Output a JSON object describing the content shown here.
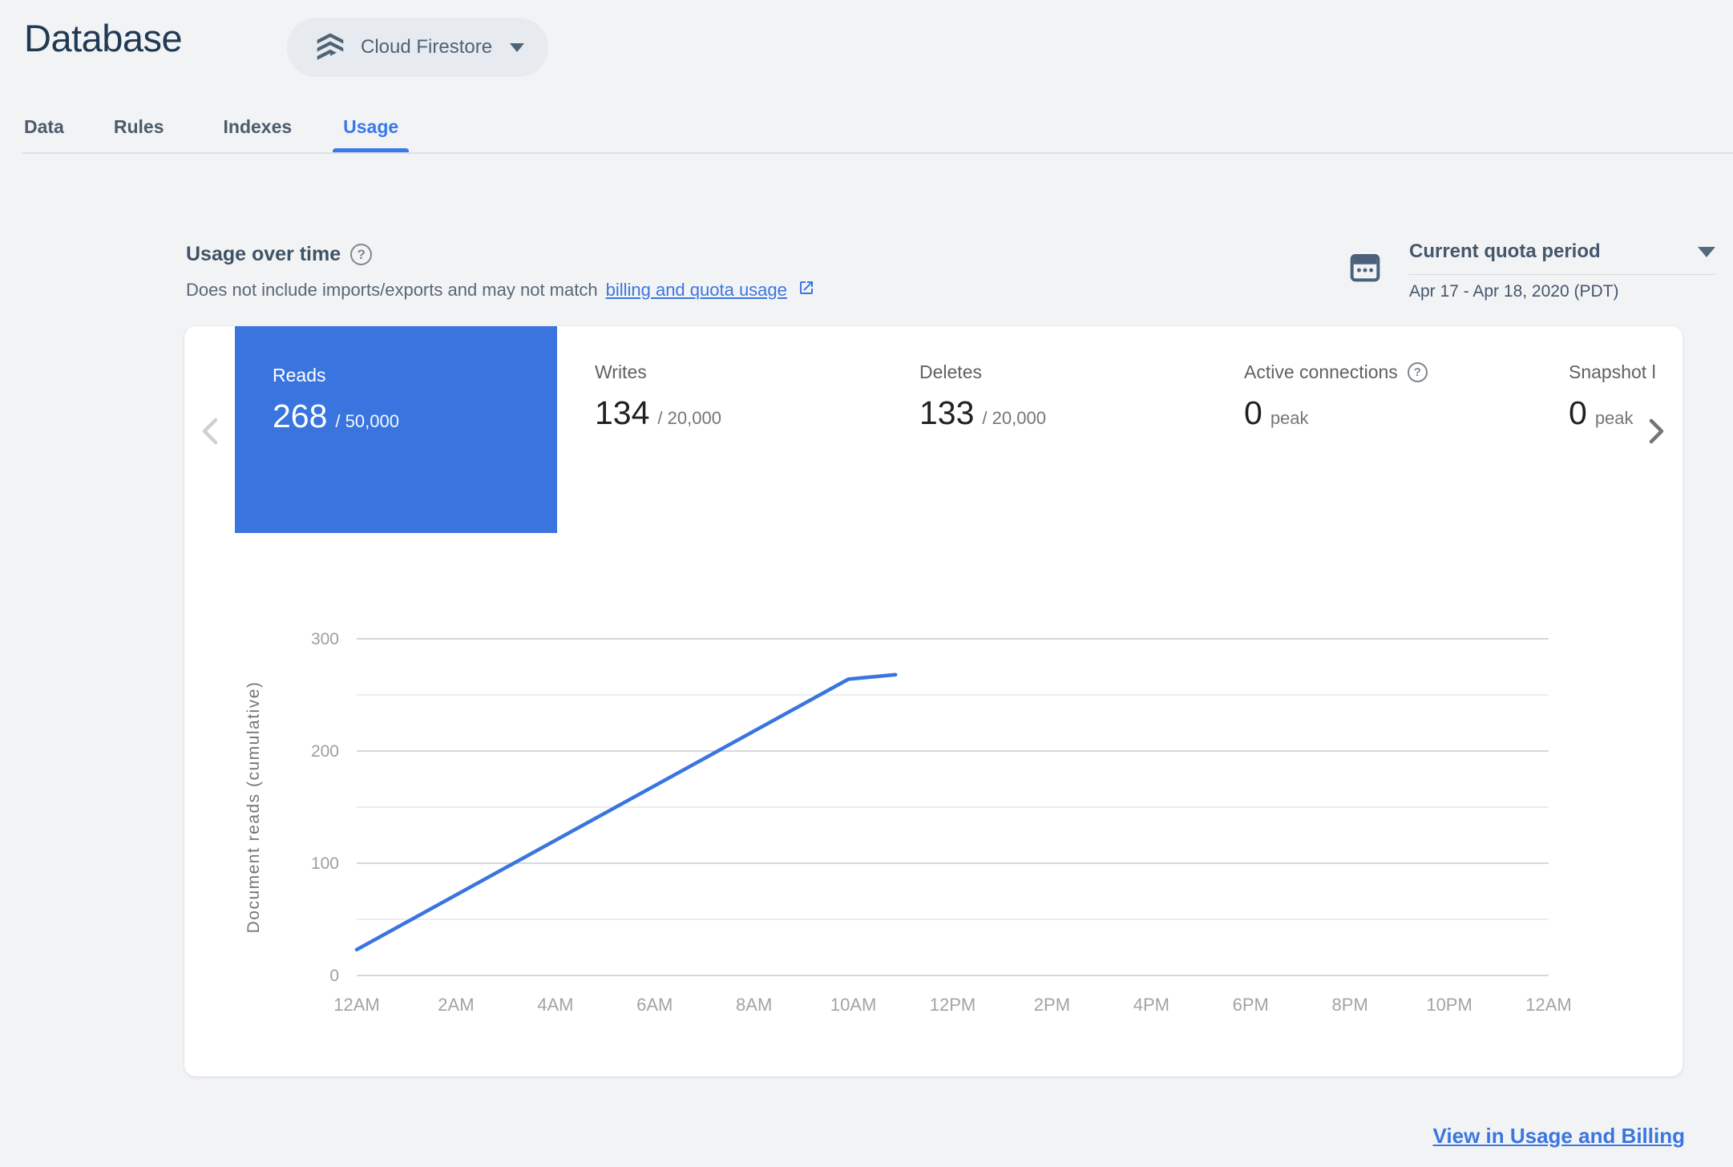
{
  "header": {
    "title": "Database",
    "product_selector": {
      "label": "Cloud Firestore"
    }
  },
  "tabs": [
    {
      "label": "Data",
      "active": false
    },
    {
      "label": "Rules",
      "active": false
    },
    {
      "label": "Indexes",
      "active": false
    },
    {
      "label": "Usage",
      "active": true
    }
  ],
  "usage_section": {
    "heading": "Usage over time",
    "description_prefix": "Does not include imports/exports and may not match",
    "description_link": "billing and quota usage",
    "period_selector": {
      "label": "Current quota period",
      "range": "Apr 17 - Apr 18, 2020 (PDT)"
    }
  },
  "metric_cards": [
    {
      "label": "Reads",
      "value": "268",
      "suffix": "/ 50,000",
      "selected": true
    },
    {
      "label": "Writes",
      "value": "134",
      "suffix": "/ 20,000",
      "selected": false
    },
    {
      "label": "Deletes",
      "value": "133",
      "suffix": "/ 20,000",
      "selected": false
    },
    {
      "label": "Active connections",
      "value": "0",
      "suffix": "peak",
      "selected": false
    },
    {
      "label": "Snapshot listeners",
      "value": "0",
      "suffix": "peak",
      "selected": false
    }
  ],
  "chart_data": {
    "type": "line",
    "title": "",
    "xlabel": "",
    "ylabel": "Document reads (cumulative)",
    "x_ticks": [
      "12AM",
      "2AM",
      "4AM",
      "6AM",
      "8AM",
      "10AM",
      "12PM",
      "2PM",
      "4PM",
      "6PM",
      "8PM",
      "10PM",
      "12AM"
    ],
    "x_range_hours": [
      0,
      24
    ],
    "ylim": [
      0,
      300
    ],
    "y_ticks": [
      0,
      100,
      200,
      300
    ],
    "minor_gridline_step": 50,
    "grid": true,
    "legend": "none",
    "series": [
      {
        "name": "Document reads (cumulative)",
        "color": "#3a75df",
        "points_hour_value": [
          [
            0,
            23
          ],
          [
            9.9,
            264
          ],
          [
            10.85,
            268
          ]
        ]
      }
    ]
  },
  "footer": {
    "link_label": "View in Usage and Billing"
  },
  "colors": {
    "accent_blue": "#3b76e0",
    "selected_card_blue": "#3a75df",
    "page_background": "#f2f3f5",
    "panel_background": "#ffffff",
    "title_navy": "#203a53",
    "slate_text": "#44576b",
    "gray_label": "#616161",
    "value_dark": "#212121",
    "tick_gray": "#9e9e9e",
    "gridline_major": "#d6d8db",
    "gridline_minor": "#ededef"
  }
}
